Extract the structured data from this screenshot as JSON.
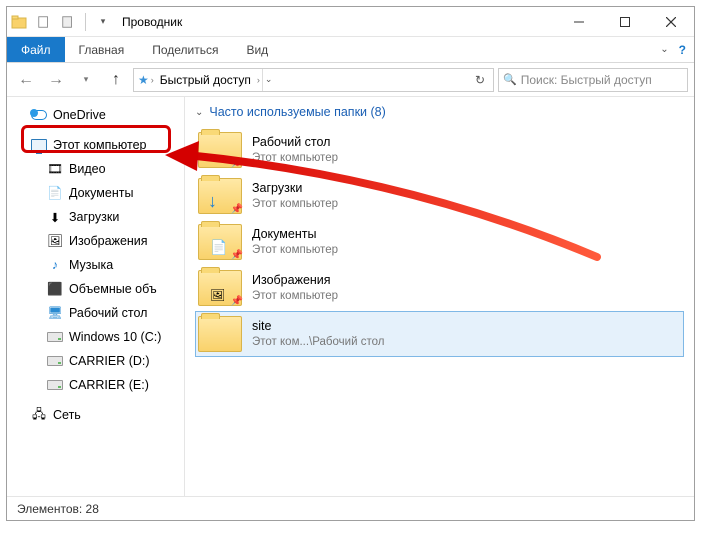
{
  "window": {
    "title": "Проводник"
  },
  "ribbon": {
    "file": "Файл",
    "home": "Главная",
    "share": "Поделиться",
    "view": "Вид"
  },
  "address": {
    "crumb_root": "Быстрый доступ"
  },
  "search": {
    "placeholder": "Поиск: Быстрый доступ"
  },
  "nav": {
    "onedrive": "OneDrive",
    "this_pc": "Этот компьютер",
    "videos": "Видео",
    "documents": "Документы",
    "downloads": "Загрузки",
    "pictures": "Изображения",
    "music": "Музыка",
    "objects3d": "Объемные объ",
    "desktop": "Рабочий стол",
    "c_drive": "Windows 10 (C:)",
    "d_drive": "CARRIER (D:)",
    "e_drive": "CARRIER (E:)",
    "network": "Сеть"
  },
  "group": {
    "title": "Часто используемые папки (8)"
  },
  "items": {
    "desktop": {
      "name": "Рабочий стол",
      "sub": "Этот компьютер"
    },
    "downloads": {
      "name": "Загрузки",
      "sub": "Этот компьютер"
    },
    "documents": {
      "name": "Документы",
      "sub": "Этот компьютер"
    },
    "pictures": {
      "name": "Изображения",
      "sub": "Этот компьютер"
    },
    "site": {
      "name": "site",
      "sub": "Этот ком...\\Рабочий стол"
    }
  },
  "status": {
    "elements_label": "Элементов:",
    "count": "28"
  }
}
